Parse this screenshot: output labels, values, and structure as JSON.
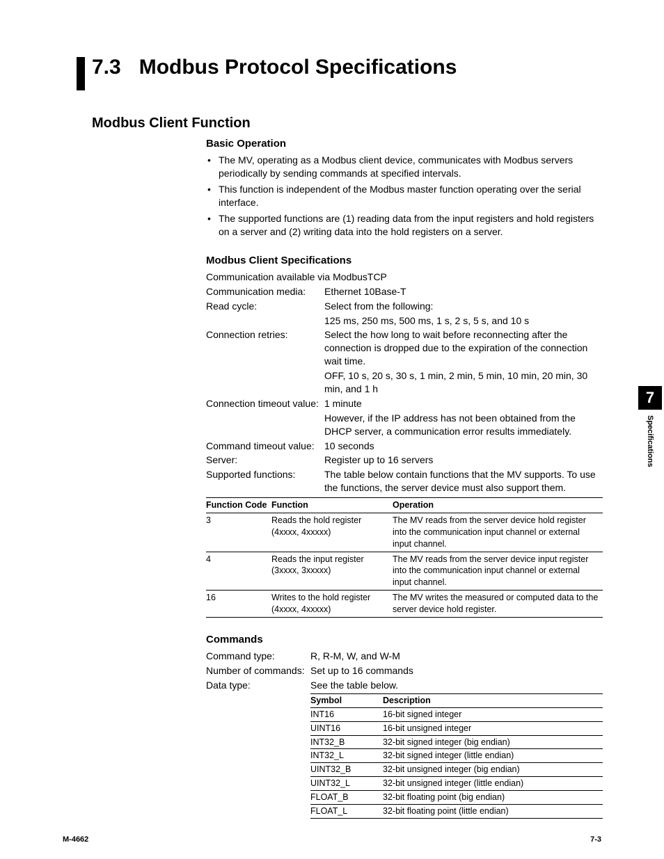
{
  "heading": {
    "number": "7.3",
    "title": "Modbus Protocol Specifications"
  },
  "h2": "Modbus Client Function",
  "basic": {
    "title": "Basic Operation",
    "bullets": [
      "The MV, operating as a Modbus client device, communicates with Modbus servers periodically by sending commands at specified intervals.",
      "This function is independent of the Modbus master function operating over the serial interface.",
      "The supported functions are (1) reading data from the input registers and hold registers on a server and (2) writing data into the hold registers on a server."
    ]
  },
  "client_specs": {
    "title": "Modbus Client Specifications",
    "intro": "Communication available via ModbusTCP",
    "rows": [
      {
        "k": "Communication media:",
        "v": "Ethernet 10Base-T"
      },
      {
        "k": "Read cycle:",
        "v": "Select from the following:"
      },
      {
        "k": "",
        "v": "125 ms, 250 ms, 500 ms, 1 s, 2 s, 5 s, and 10 s"
      },
      {
        "k": "Connection retries:",
        "v": "Select the how long to wait before reconnecting after the connection is dropped due to the expiration of the connection wait time."
      },
      {
        "k": "",
        "v": "OFF, 10 s, 20 s, 30 s, 1 min, 2 min, 5 min, 10 min, 20 min, 30 min, and 1 h"
      },
      {
        "k": "Connection timeout value:",
        "v": "1 minute"
      },
      {
        "k": "",
        "v": "However, if the IP address has not been obtained from the DHCP server, a communication error results immediately."
      },
      {
        "k": "Command timeout value:",
        "v": "10 seconds"
      },
      {
        "k": "Server:",
        "v": "Register up to 16 servers"
      },
      {
        "k": "Supported functions:",
        "v": "The table below contain functions that the MV supports. To use the functions, the server device must also support them."
      }
    ]
  },
  "func_table": {
    "headers": [
      "Function Code",
      "Function",
      "Operation"
    ],
    "rows": [
      {
        "code": "3",
        "func": "Reads the hold register (4xxxx, 4xxxxx)",
        "op": "The MV reads from the server device hold register into the communication input channel or external input channel."
      },
      {
        "code": "4",
        "func": "Reads the input register (3xxxx, 3xxxxx)",
        "op": "The MV reads from the server device input register into the communication input channel or external input channel."
      },
      {
        "code": "16",
        "func": "Writes to the hold register (4xxxx, 4xxxxx)",
        "op": "The MV writes the measured or computed data to the server device hold register."
      }
    ]
  },
  "commands": {
    "title": "Commands",
    "rows": [
      {
        "k": "Command type:",
        "v": "R, R-M, W, and W-M"
      },
      {
        "k": "Number of commands:",
        "v": "Set up to 16 commands"
      },
      {
        "k": "Data type:",
        "v": "See the table below."
      }
    ]
  },
  "data_types": {
    "headers": [
      "Symbol",
      "Description"
    ],
    "rows": [
      {
        "sym": "INT16",
        "desc": "16-bit signed integer"
      },
      {
        "sym": "UINT16",
        "desc": "16-bit unsigned integer"
      },
      {
        "sym": "INT32_B",
        "desc": "32-bit signed integer (big endian)"
      },
      {
        "sym": "INT32_L",
        "desc": "32-bit signed integer (little endian)"
      },
      {
        "sym": "UINT32_B",
        "desc": "32-bit unsigned integer (big endian)"
      },
      {
        "sym": "UINT32_L",
        "desc": "32-bit unsigned integer (little endian)"
      },
      {
        "sym": "FLOAT_B",
        "desc": "32-bit floating point (big endian)"
      },
      {
        "sym": "FLOAT_L",
        "desc": "32-bit floating point (little endian)"
      }
    ]
  },
  "side": {
    "chapter": "7",
    "label": "Specifications"
  },
  "footer": {
    "left": "M-4662",
    "right": "7-3"
  }
}
